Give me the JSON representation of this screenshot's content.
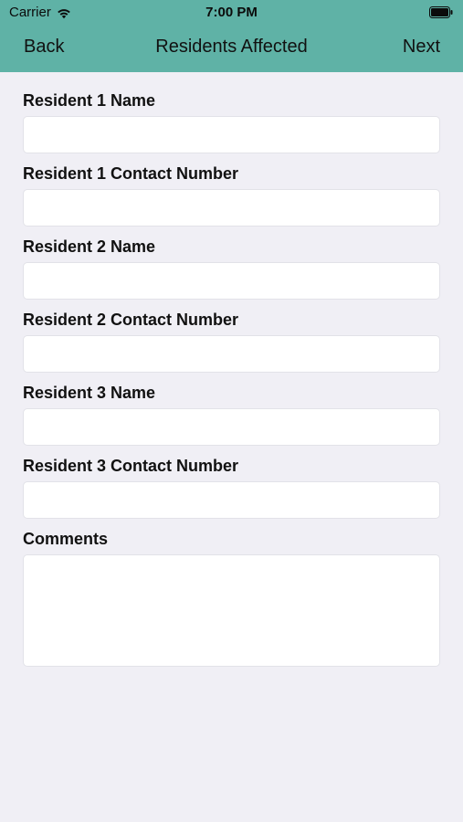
{
  "status_bar": {
    "carrier": "Carrier",
    "time": "7:00 PM",
    "wifi_icon": "wifi-icon",
    "battery_icon": "battery-icon"
  },
  "nav": {
    "back_label": "Back",
    "title": "Residents Affected",
    "next_label": "Next"
  },
  "form": {
    "fields": [
      {
        "label": "Resident 1 Name",
        "value": "",
        "placeholder": ""
      },
      {
        "label": "Resident 1 Contact Number",
        "value": "",
        "placeholder": ""
      },
      {
        "label": "Resident 2 Name",
        "value": "",
        "placeholder": ""
      },
      {
        "label": "Resident 2 Contact Number",
        "value": "",
        "placeholder": ""
      },
      {
        "label": "Resident 3 Name",
        "value": "",
        "placeholder": ""
      },
      {
        "label": "Resident 3 Contact Number",
        "value": "",
        "placeholder": ""
      }
    ],
    "comments": {
      "label": "Comments",
      "value": "",
      "placeholder": ""
    }
  },
  "colors": {
    "header_bg": "#5fb2a6",
    "page_bg": "#f0eff5",
    "input_bg": "#ffffff"
  }
}
